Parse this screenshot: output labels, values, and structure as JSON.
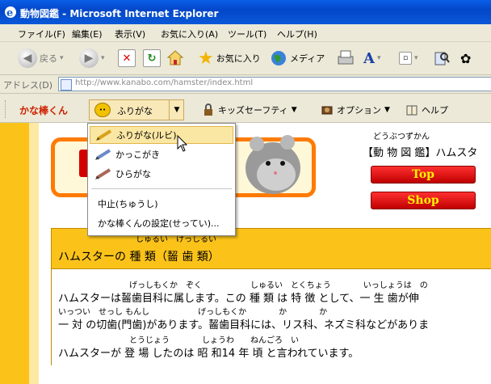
{
  "window": {
    "title": "動物図鑑 - Microsoft Internet Explorer"
  },
  "menubar": {
    "items": [
      "ファイル(F)",
      "編集(E)",
      "表示(V)",
      "お気に入り(A)",
      "ツール(T)",
      "ヘルプ(H)"
    ]
  },
  "toolbar": {
    "back": "戻る",
    "favorites": "お気に入り",
    "media": "メディア"
  },
  "address": {
    "label": "アドレス(D)",
    "url": "http://www.kanabo.com/hamster/index.html"
  },
  "kana_toolbar": {
    "logo": "かな棒くん",
    "furigana": "ふりがな",
    "kids_safety": "キッズセーフティ",
    "options": "オプション",
    "help": "ヘルプ"
  },
  "dropdown": {
    "items": [
      "ふりがな(ルビ)",
      "かっこがき",
      "ひらがな"
    ],
    "stop": "中止(ちゅうし)",
    "settings": "かな棒くんの設定(せってい)..."
  },
  "page": {
    "site_ruby": "どうぶつずかん",
    "site_title": "【動 物 図 鑑】ハムスタ",
    "top_button": "Top",
    "shop_button": "Shop",
    "section_ruby": "しゅるい　けっしるい",
    "section_title": "ハムスターの 種 類（齧 歯 類）",
    "lines": [
      {
        "ruby": "げっしもくか　ぞく　　　　　　しゅるい　とくちょう　　　　いっしょうは　の",
        "text": "ハムスターは齧歯目科に属します。この 種 類 は 特 徴 として、一 生 歯が伸"
      },
      {
        "ruby": "いっつい　せっし もんし　　　　　　げっしもくか　　　　か　　　　か",
        "text": "一 対 の切歯(門歯)があります。齧歯目科には、リス科、ネズミ科などがありま"
      },
      {
        "ruby": "とうじょう　　　　しょうわ　　ねんごろ　い",
        "text": "ハムスターが 登 場 したのは 昭 和14 年 頃 と言われています。"
      }
    ]
  },
  "colors": {
    "accent_orange": "#ff7a00",
    "section_yellow": "#fbc31a",
    "button_red": "#d40000"
  }
}
